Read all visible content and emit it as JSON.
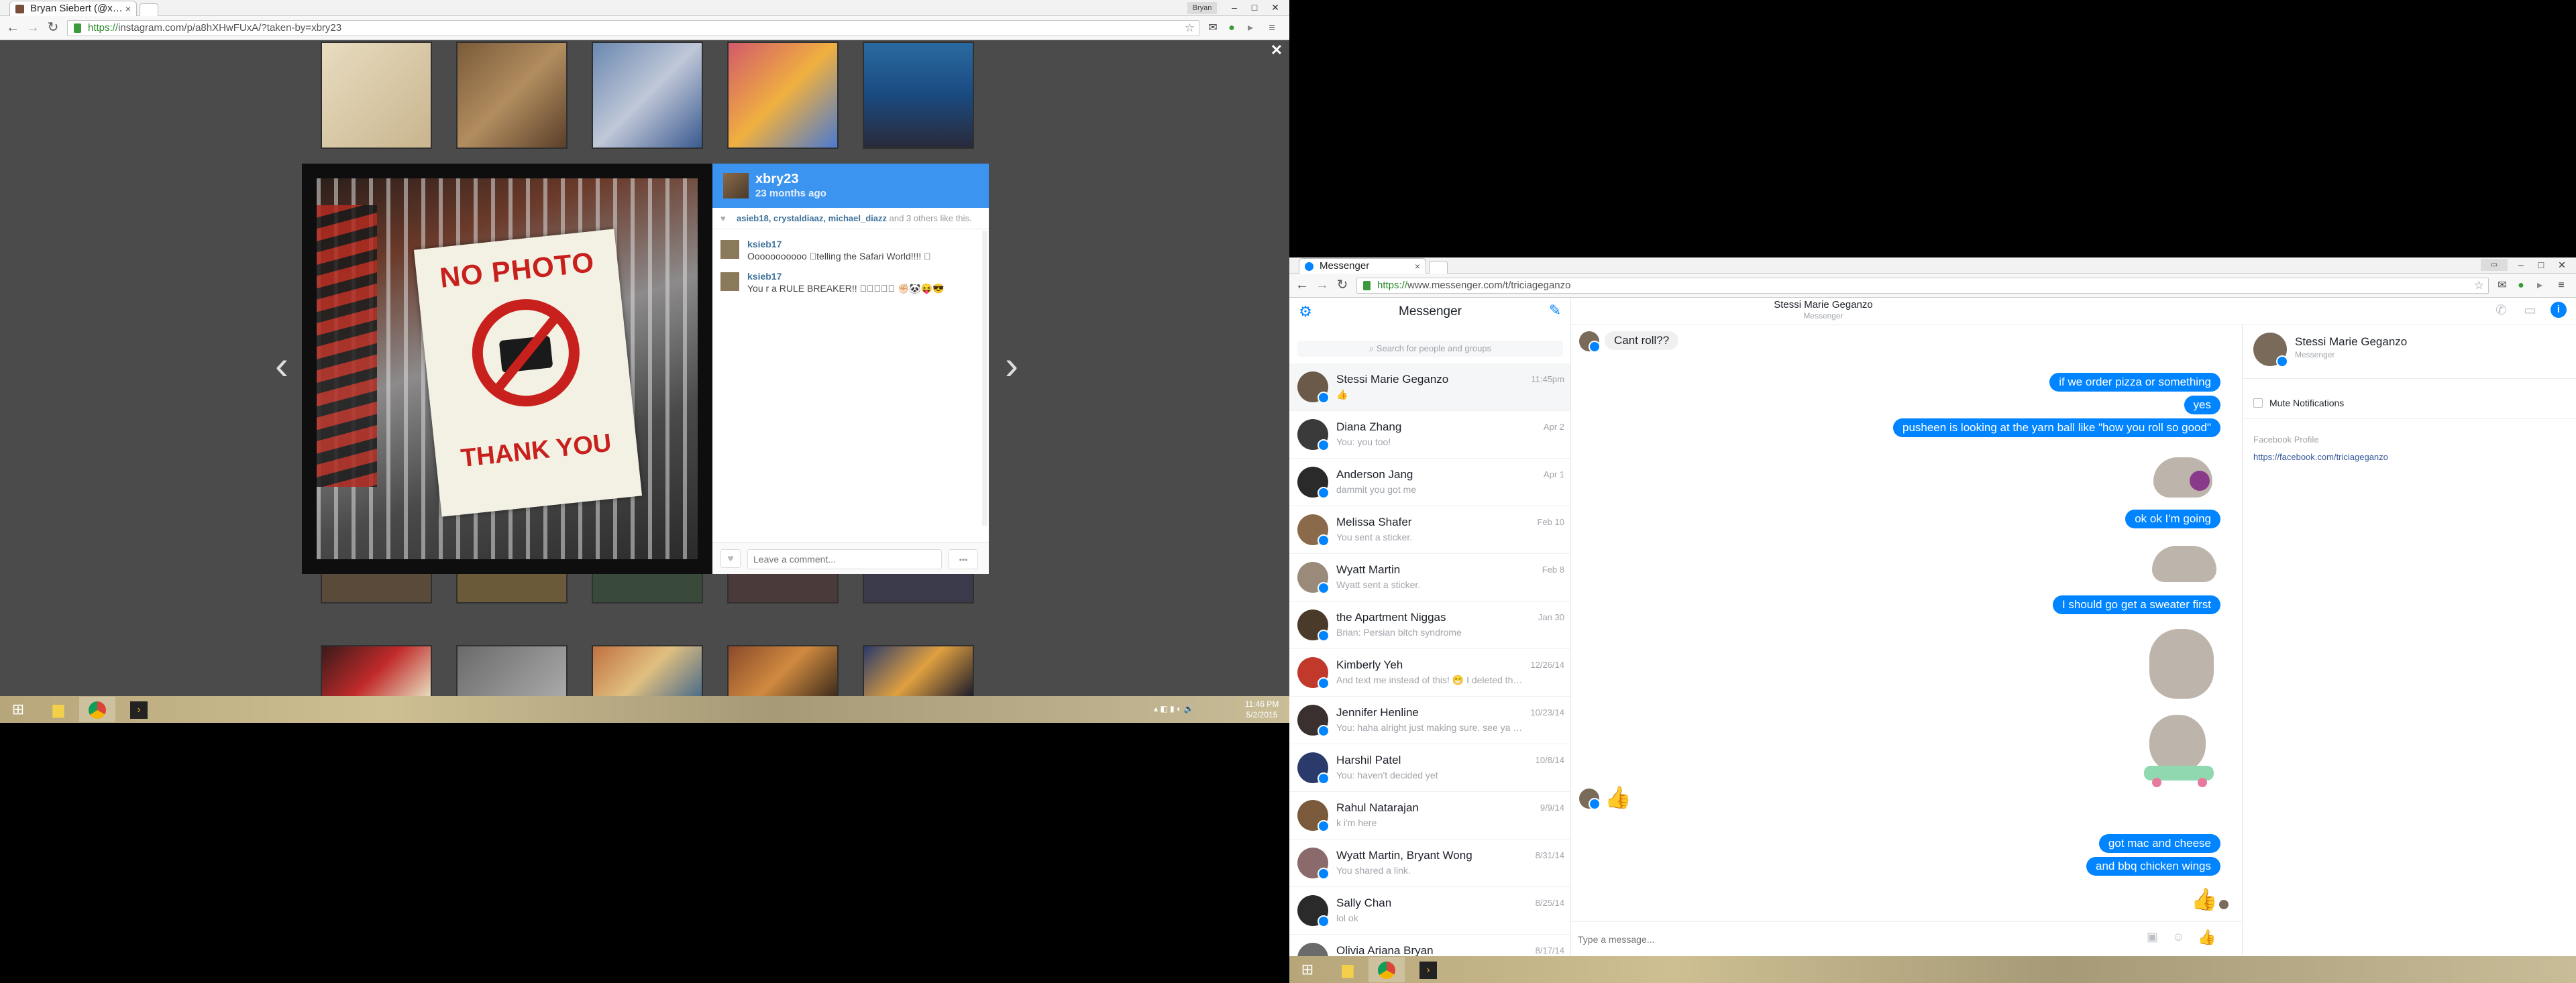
{
  "instagram_window": {
    "tab_title": "Bryan Siebert (@xbry23) ...",
    "url_scheme": "https://",
    "url_rest": "instagram.com/p/a8hXHwFUxA/?taken-by=xbry23",
    "profile_button": "Bryan",
    "close_overlay": "✕",
    "prev_arrow": "‹",
    "next_arrow": "›",
    "photo_sign": {
      "line1": "NO PHOTO",
      "line2": "THANK YOU"
    },
    "post": {
      "username": "xbry23",
      "time_ago": "23 months ago",
      "likes_prefix": "asieb18, crystaldiaaz, michael_diazz",
      "likes_suffix": "and 3 others like this.",
      "comments": [
        {
          "user": "ksieb17",
          "text": "Ooooooooooo 􀀁telling the Safari World!!!! 􀀁"
        },
        {
          "user": "ksieb17",
          "text": "You r a RULE BREAKER!! 􀀁􀀁􀀁􀀁􀀁 ✊🏻🐼😝😎"
        }
      ],
      "comment_placeholder": "Leave a comment...",
      "more_button": "•••"
    }
  },
  "taskbar_left": {
    "start_icon": "windows-start-icon",
    "clock_time": "11:46 PM",
    "clock_date": "5/2/2015"
  },
  "messenger_window": {
    "tab_title": "Messenger",
    "url_scheme": "https://",
    "url_rest": "www.messenger.com/t/triciageganzo",
    "sidebar_title": "Messenger",
    "search_placeholder": "Search for people and groups",
    "conversations": [
      {
        "name": "Stessi Marie Geganzo",
        "snippet": "👍",
        "date": "11:45pm"
      },
      {
        "name": "Diana Zhang",
        "snippet": "You: you too!",
        "date": "Apr 2"
      },
      {
        "name": "Anderson Jang",
        "snippet": "dammit you got me",
        "date": "Apr 1"
      },
      {
        "name": "Melissa Shafer",
        "snippet": "You sent a sticker.",
        "date": "Feb 10"
      },
      {
        "name": "Wyatt Martin",
        "snippet": "Wyatt sent a sticker.",
        "date": "Feb 8"
      },
      {
        "name": "the Apartment Niggas",
        "snippet": "Brian: Persian bitch syndrome",
        "date": "Jan 30"
      },
      {
        "name": "Kimberly Yeh",
        "snippet": "And text me instead of this! 😁 I deleted the app which i...",
        "date": "12/26/14"
      },
      {
        "name": "Jennifer Henline",
        "snippet": "You: haha alright just making sure. see ya then",
        "date": "10/23/14"
      },
      {
        "name": "Harshil Patel",
        "snippet": "You: haven't decided yet",
        "date": "10/8/14"
      },
      {
        "name": "Rahul Natarajan",
        "snippet": "k i'm here",
        "date": "9/9/14"
      },
      {
        "name": "Wyatt Martin, Bryant Wong",
        "snippet": "You shared a link.",
        "date": "8/31/14"
      },
      {
        "name": "Sally Chan",
        "snippet": "lol ok",
        "date": "8/25/14"
      },
      {
        "name": "Olivia Ariana Bryan",
        "snippet": "",
        "date": "8/17/14"
      }
    ],
    "chat_header_name": "Stessi Marie Geganzo",
    "chat_header_sub": "Messenger",
    "messages": [
      {
        "from": "them",
        "text": "Cant roll??"
      },
      {
        "from": "me",
        "text": "if we order pizza or something"
      },
      {
        "from": "me",
        "text": "yes"
      },
      {
        "from": "me",
        "text": "pusheen is looking at the yarn ball like \"how you roll so good\""
      },
      {
        "from": "me",
        "text": "ok ok I'm going"
      },
      {
        "from": "me",
        "text": "I should go get a sweater first"
      },
      {
        "from": "me",
        "text": "got mac and cheese"
      },
      {
        "from": "me",
        "text": "and bbq chicken wings"
      }
    ],
    "compose_placeholder": "Type a message...",
    "right_panel": {
      "name": "Stessi Marie Geganzo",
      "sub": "Messenger",
      "mute_label": "Mute Notifications",
      "profile_label": "Facebook Profile",
      "profile_link": "https://facebook.com/triciageganzo"
    }
  },
  "colors": {
    "messenger_blue": "#0084ff",
    "instagram_blue": "#3b94ef",
    "overlay_gray": "#4b4b4b"
  }
}
